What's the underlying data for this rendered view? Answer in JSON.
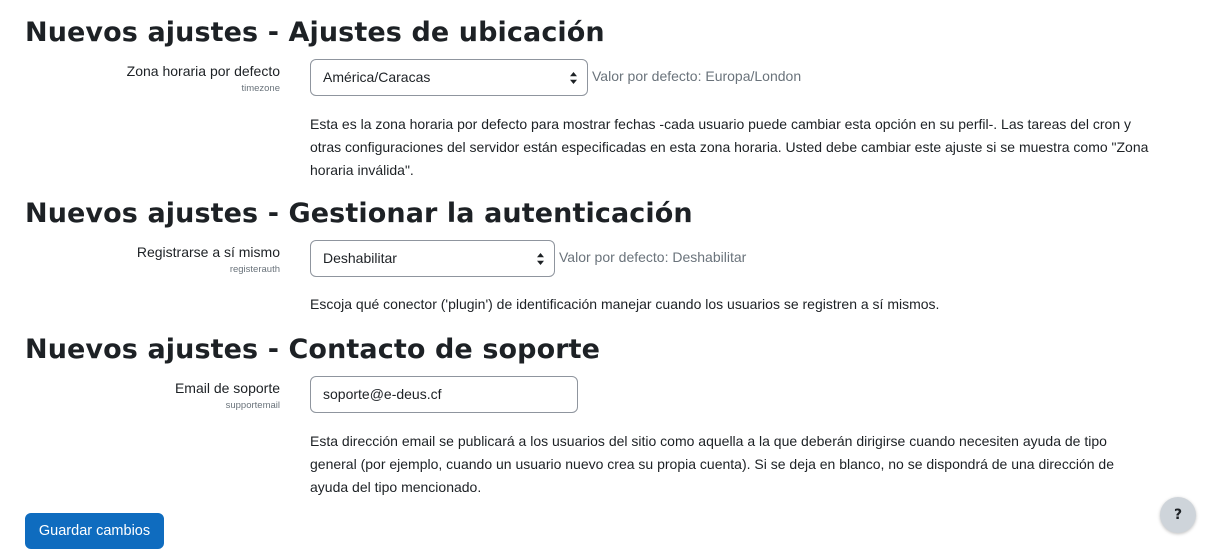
{
  "sections": [
    {
      "heading": "Nuevos ajustes - Ajustes de ubicación",
      "setting": {
        "label": "Zona horaria por defecto",
        "internal_name": "timezone",
        "control": "select",
        "value": "América/Caracas",
        "default_note": "Valor por defecto: Europa/London",
        "description": "Esta es la zona horaria por defecto para mostrar fechas -cada usuario puede cambiar esta opción en su perfil-. Las tareas del cron y otras configuraciones del servidor están especificadas en esta zona horaria. Usted debe cambiar este ajuste si se muestra como \"Zona horaria inválida\"."
      }
    },
    {
      "heading": "Nuevos ajustes - Gestionar la autenticación",
      "setting": {
        "label": "Registrarse a sí mismo",
        "internal_name": "registerauth",
        "control": "select",
        "value": "Deshabilitar",
        "default_note": "Valor por defecto: Deshabilitar",
        "description": "Escoja qué conector ('plugin') de identificación manejar cuando los usuarios se registren a sí mismos."
      }
    },
    {
      "heading": "Nuevos ajustes - Contacto de soporte",
      "setting": {
        "label": "Email de soporte",
        "internal_name": "supportemail",
        "control": "text",
        "value": "soporte@e-deus.cf",
        "description": "Esta dirección email se publicará a los usuarios del sitio como aquella a la que deberán dirigirse cuando necesiten ayuda de tipo general (por ejemplo, cuando un usuario nuevo crea su propia cuenta). Si se deja en blanco, no se dispondrá de una dirección de ayuda del tipo mencionado."
      }
    }
  ],
  "save_button_label": "Guardar cambios",
  "help_button_label": "?",
  "icons": {
    "select_arrow": "chevron-up-down-icon"
  },
  "colors": {
    "primary": "#0f6cbf",
    "muted_text": "#6a737b",
    "text": "#1d2125",
    "help_bg": "#ced4da"
  }
}
